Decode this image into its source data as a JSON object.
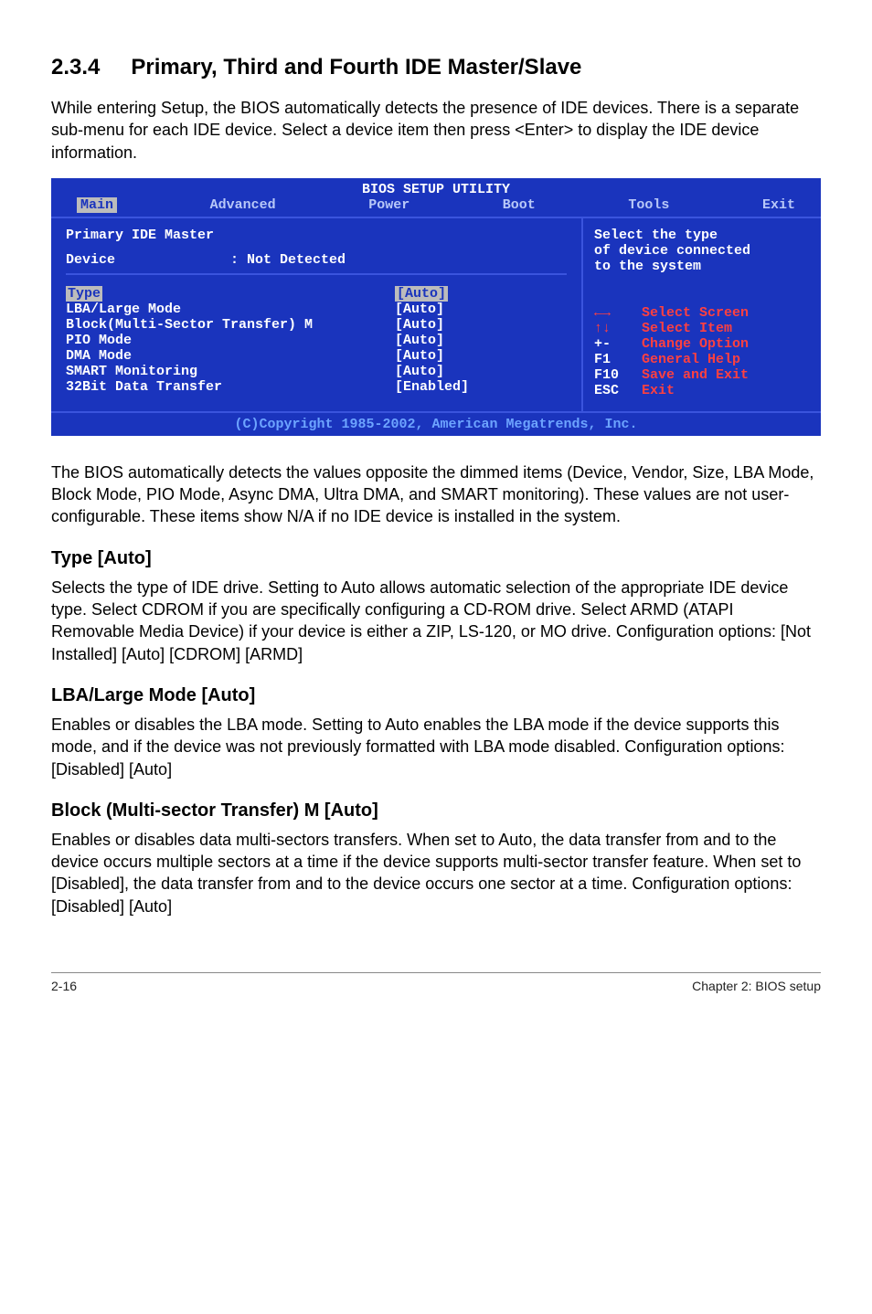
{
  "section": {
    "number": "2.3.4",
    "title": "Primary, Third and Fourth IDE Master/Slave"
  },
  "intro": "While entering Setup, the BIOS automatically detects the presence of IDE devices. There is a separate sub-menu for each IDE device. Select a device item then press <Enter> to display the IDE device information.",
  "bios": {
    "title": "BIOS SETUP UTILITY",
    "menu": [
      "Main",
      "Advanced",
      "Power",
      "Boot",
      "Tools",
      "Exit"
    ],
    "selected_tab": "Main",
    "header_item": "Primary IDE Master",
    "device_label": "Device",
    "device_value": ": Not Detected",
    "items": [
      {
        "label": "Type",
        "value": "[Auto]",
        "selected": true
      },
      {
        "label": "LBA/Large Mode",
        "value": "[Auto]"
      },
      {
        "label": "Block(Multi-Sector Transfer) M",
        "value": "[Auto]"
      },
      {
        "label": "PIO Mode",
        "value": "[Auto]"
      },
      {
        "label": "DMA Mode",
        "value": "[Auto]"
      },
      {
        "label": "SMART Monitoring",
        "value": "[Auto]"
      },
      {
        "label": "32Bit Data Transfer",
        "value": "[Enabled]"
      }
    ],
    "help": {
      "line1": "Select the type",
      "line2": "of device connected",
      "line3": "to the system"
    },
    "keys": [
      {
        "k": "←→",
        "d": "Select Screen"
      },
      {
        "k": "↑↓",
        "d": "Select Item"
      },
      {
        "k": "+-",
        "d": "Change Option"
      },
      {
        "k": "F1",
        "d": "General Help"
      },
      {
        "k": "F10",
        "d": "Save and Exit"
      },
      {
        "k": "ESC",
        "d": "Exit"
      }
    ],
    "footer": "(C)Copyright 1985-2002, American Megatrends, Inc."
  },
  "para_after_bios": "The BIOS automatically detects the values opposite the dimmed items (Device, Vendor, Size, LBA Mode, Block Mode, PIO Mode, Async DMA, Ultra DMA, and SMART monitoring). These values are not user-configurable. These items show N/A if no IDE device is installed in the system.",
  "subs": [
    {
      "heading": "Type [Auto]",
      "body": "Selects the type of IDE drive. Setting to Auto allows automatic selection of the appropriate IDE device type. Select CDROM if you are specifically configuring a CD-ROM drive. Select ARMD (ATAPI Removable Media Device) if your device is either a ZIP, LS-120, or MO drive. Configuration options: [Not Installed] [Auto] [CDROM] [ARMD]"
    },
    {
      "heading": "LBA/Large Mode [Auto]",
      "body": "Enables or disables the LBA mode. Setting to Auto enables the LBA mode if the device supports this mode, and if the device was not previously formatted with LBA mode disabled. Configuration options: [Disabled] [Auto]"
    },
    {
      "heading": "Block (Multi-sector Transfer) M [Auto]",
      "body": "Enables or disables data multi-sectors transfers. When set to Auto, the data transfer from and to the device occurs multiple sectors at a time if the device supports multi-sector transfer feature. When set to [Disabled], the data transfer from and to the device occurs one sector at a time. Configuration options: [Disabled] [Auto]"
    }
  ],
  "footer": {
    "left": "2-16",
    "right": "Chapter 2: BIOS setup"
  }
}
